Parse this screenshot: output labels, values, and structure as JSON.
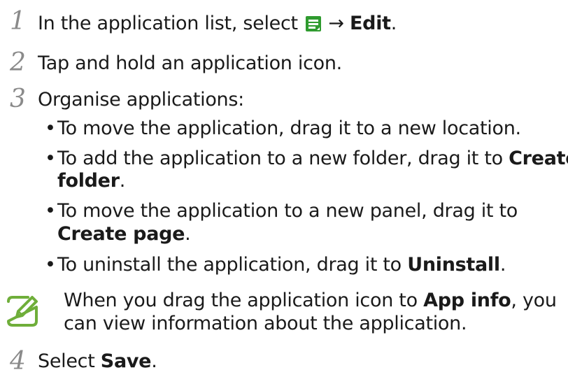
{
  "steps": [
    {
      "number": "1",
      "pre": "In the application list, select",
      "icon": "menu-icon",
      "arrow": "→",
      "bold": "Edit",
      "post": "."
    },
    {
      "number": "2",
      "text": "Tap and hold an application icon."
    },
    {
      "number": "3",
      "text": "Organise applications:",
      "bullets": [
        {
          "pre": "To move the application, drag it to a new location."
        },
        {
          "pre": "To add the application to a new folder, drag it to",
          "bold_a": "Create",
          "bold_b": "folder",
          "post": "."
        },
        {
          "pre": "To move the application to a new panel, drag it to",
          "bold": "Create page",
          "post": "."
        },
        {
          "pre": "To uninstall the application, drag it to",
          "bold": "Uninstall",
          "post": "."
        }
      ]
    },
    {
      "number": "4",
      "pre": "Select",
      "bold": "Save",
      "post": "."
    }
  ],
  "note": {
    "icon": "note-pencil-icon",
    "pre": "When you drag the application icon to",
    "bold": "App info",
    "post": ", you",
    "line2": "can view information about the application."
  },
  "bullet_glyph": "•",
  "colors": {
    "step_number": "#8a8a8a",
    "icon_green": "#2f9b2f",
    "note_icon_green": "#6fae3a"
  }
}
